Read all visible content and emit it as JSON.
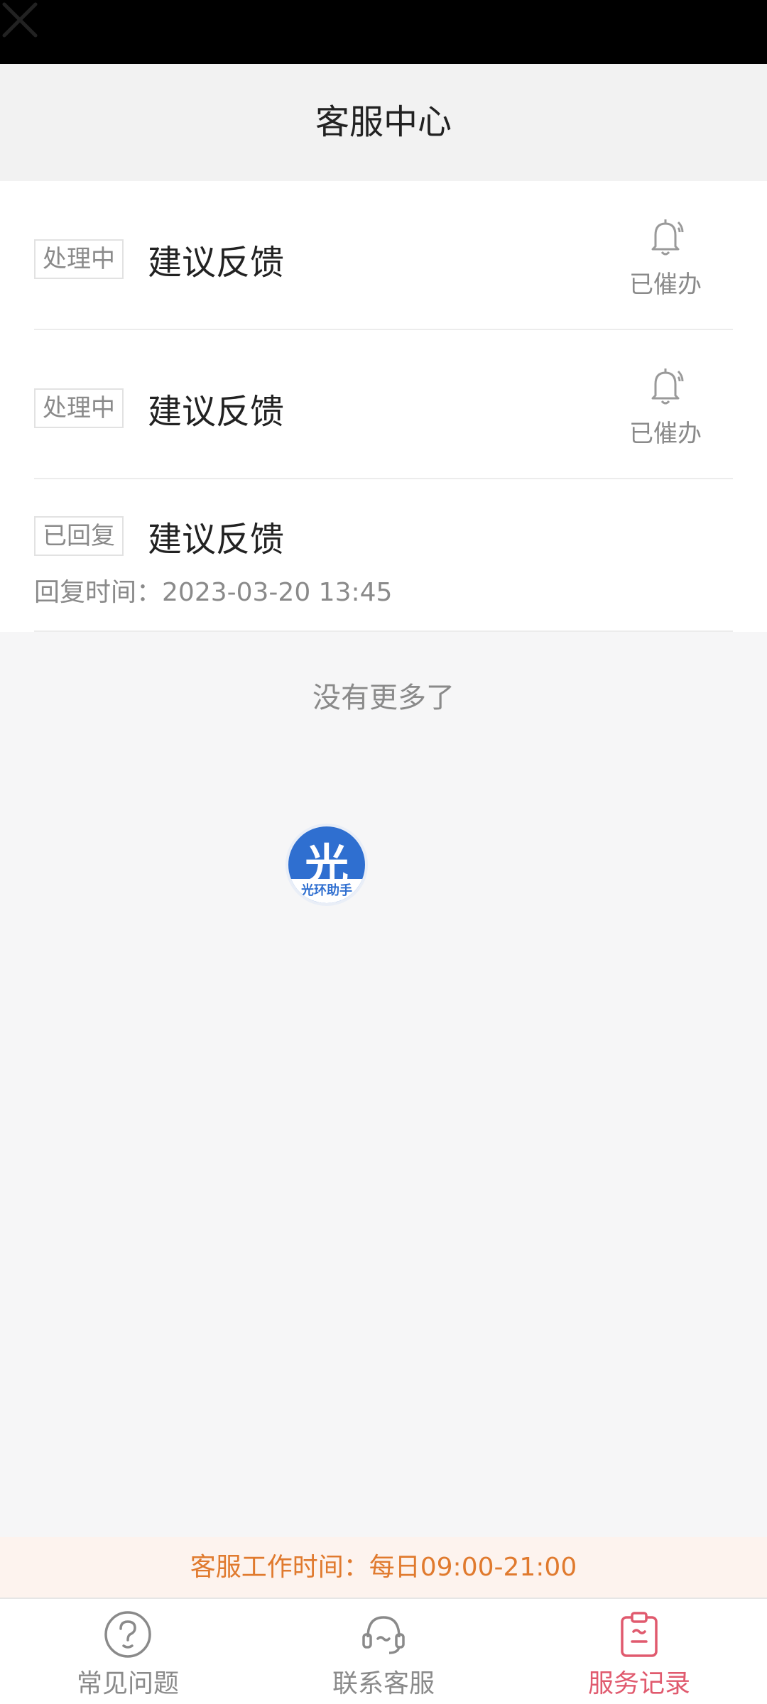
{
  "header": {
    "title": "客服中心"
  },
  "records": [
    {
      "status": "处理中",
      "title": "建议反馈",
      "reminder_label": "已催办"
    },
    {
      "status": "处理中",
      "title": "建议反馈",
      "reminder_label": "已催办"
    },
    {
      "status": "已回复",
      "title": "建议反馈",
      "reply_time_label": "回复时间：",
      "reply_time": "2023-03-20 13:45"
    }
  ],
  "list_end_text": "没有更多了",
  "floating_assistant": {
    "glyph": "光",
    "label": "光环助手"
  },
  "service_hours": "客服工作时间：每日09:00-21:00",
  "tabs": [
    {
      "label": "常见问题",
      "icon": "question-circle-icon",
      "active": false
    },
    {
      "label": "联系客服",
      "icon": "headset-icon",
      "active": false
    },
    {
      "label": "服务记录",
      "icon": "clipboard-icon",
      "active": true
    }
  ],
  "colors": {
    "accent": "#e05a6e",
    "hours_text": "#e07a2e",
    "assistant_blue": "#2f6fd0"
  }
}
